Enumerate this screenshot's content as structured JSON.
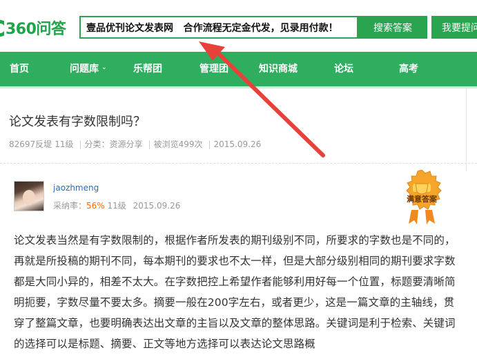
{
  "header": {
    "logo_text": "360问答",
    "search_value": "壹品优刊论文发表网   合作流程无定金代发，见录用付款！",
    "search_button": "搜索答案",
    "ask_button": "我要提问"
  },
  "nav": {
    "items": [
      {
        "label": "首页"
      },
      {
        "label": "问题库",
        "has_dropdown": true
      },
      {
        "label": "乐帮团"
      },
      {
        "label": "管理团"
      },
      {
        "label": "知识商城"
      },
      {
        "label": "论坛"
      },
      {
        "label": "高考"
      }
    ]
  },
  "question": {
    "title": "论文发表有字数限制吗？",
    "asker": "82697反堤",
    "level": "11级",
    "category": "分类：资源分享",
    "views": "被浏览499次",
    "date": "2015.09.26"
  },
  "answer": {
    "user_name": "jaozhmeng",
    "adopt_label": "采纳率：",
    "adopt_rate": "56%",
    "level": "11级",
    "date": "2015.09.26",
    "badge_label": "满意答案",
    "text": "论文发表当然是有字数限制的，根据作者所发表的期刊级别不同，所要求的字数也是不同的，再就是所投稿的期刊不同，每本期刊的要求也不太一样，但是大部分级别相同的期刊要求字数都是大同小异的，相差不太大。在字数把控上希望作者能够利用好每一个位置，标题要清晰简明扼要，字数尽量不要太多。摘要一般在200字左右，或者更少，这是一篇文章的主轴线，贯穿了整篇文章，也要明确表达出文章的主旨以及文章的整体思路。关键词是利于检索、关键词的选择可以是标题、摘要、正文等地方选择可以表达论文思路概"
  },
  "colors": {
    "brand_green": "#2fae5f",
    "annotation_red": "#e8413a",
    "link_blue": "#2f6ab5",
    "rate_orange": "#ff6a00"
  }
}
